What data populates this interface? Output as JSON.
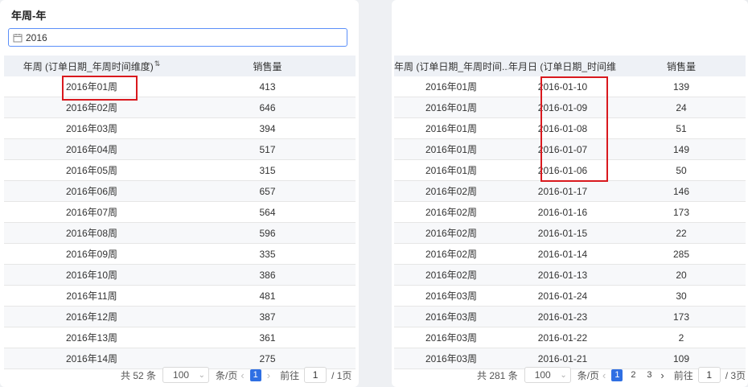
{
  "left": {
    "title": "年周-年",
    "filter_value": "2016",
    "columns": [
      "年周 (订单日期_年周时间维度)",
      "销售量"
    ],
    "rows": [
      [
        "2016年01周",
        "413"
      ],
      [
        "2016年02周",
        "646"
      ],
      [
        "2016年03周",
        "394"
      ],
      [
        "2016年04周",
        "517"
      ],
      [
        "2016年05周",
        "315"
      ],
      [
        "2016年06周",
        "657"
      ],
      [
        "2016年07周",
        "564"
      ],
      [
        "2016年08周",
        "596"
      ],
      [
        "2016年09周",
        "335"
      ],
      [
        "2016年10周",
        "386"
      ],
      [
        "2016年11周",
        "481"
      ],
      [
        "2016年12周",
        "387"
      ],
      [
        "2016年13周",
        "361"
      ],
      [
        "2016年14周",
        "275"
      ]
    ],
    "pager": {
      "total": "共 52 条",
      "page_size": "100",
      "per_page_label": "条/页",
      "pages": [
        "1"
      ],
      "goto_label": "前往",
      "goto_value": "1",
      "total_pages": "/ 1页"
    }
  },
  "right": {
    "columns": [
      "年周 (订单日期_年周时间...",
      "年月日 (订单日期_时间维...",
      "销售量"
    ],
    "rows": [
      [
        "2016年01周",
        "2016-01-10",
        "139"
      ],
      [
        "2016年01周",
        "2016-01-09",
        "24"
      ],
      [
        "2016年01周",
        "2016-01-08",
        "51"
      ],
      [
        "2016年01周",
        "2016-01-07",
        "149"
      ],
      [
        "2016年01周",
        "2016-01-06",
        "50"
      ],
      [
        "2016年02周",
        "2016-01-17",
        "146"
      ],
      [
        "2016年02周",
        "2016-01-16",
        "173"
      ],
      [
        "2016年02周",
        "2016-01-15",
        "22"
      ],
      [
        "2016年02周",
        "2016-01-14",
        "285"
      ],
      [
        "2016年02周",
        "2016-01-13",
        "20"
      ],
      [
        "2016年03周",
        "2016-01-24",
        "30"
      ],
      [
        "2016年03周",
        "2016-01-23",
        "173"
      ],
      [
        "2016年03周",
        "2016-01-22",
        "2"
      ],
      [
        "2016年03周",
        "2016-01-21",
        "109"
      ]
    ],
    "pager": {
      "total": "共 281 条",
      "page_size": "100",
      "per_page_label": "条/页",
      "pages": [
        "1",
        "2",
        "3"
      ],
      "goto_label": "前往",
      "goto_value": "1",
      "total_pages": "/ 3页"
    }
  },
  "colors": {
    "accent": "#2f6fe3",
    "highlight": "#d9191e",
    "header_bg": "#eef1f6"
  },
  "icons": [
    "calendar-icon",
    "sort-asc-icon",
    "sort-desc-icon",
    "chevron-down-icon",
    "chevron-left-icon",
    "chevron-right-icon"
  ]
}
